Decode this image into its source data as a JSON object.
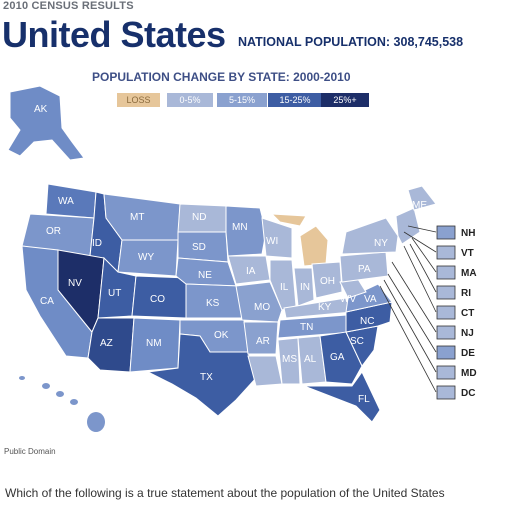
{
  "header": {
    "eyebrow": "2010 CENSUS RESULTS",
    "title": "United States",
    "national_population": "NATIONAL POPULATION: 308,745,538"
  },
  "map": {
    "subtitle": "POPULATION CHANGE BY STATE: 2000-2010",
    "legend": [
      {
        "label": "LOSS",
        "color": "#e6c69a"
      },
      {
        "label": "0-5%",
        "color": "#a9b8d8"
      },
      {
        "label": "5-15%",
        "color": "#8aa1cf"
      },
      {
        "label": "15-25%",
        "color": "#3d5da3"
      },
      {
        "label": "25%+",
        "color": "#1d2e68"
      }
    ],
    "state_labels": {
      "AK": "AK",
      "WA": "WA",
      "OR": "OR",
      "CA": "CA",
      "ID": "ID",
      "NV": "NV",
      "MT": "MT",
      "WY": "WY",
      "UT": "UT",
      "AZ": "AZ",
      "CO": "CO",
      "NM": "NM",
      "ND": "ND",
      "SD": "SD",
      "NE": "NE",
      "KS": "KS",
      "OK": "OK",
      "TX": "TX",
      "MN": "MN",
      "IA": "IA",
      "MO": "MO",
      "AR": "AR",
      "WI": "WI",
      "IL": "IL",
      "IN": "IN",
      "OH": "OH",
      "KY": "KY",
      "TN": "TN",
      "MS": "MS",
      "AL": "AL",
      "GA": "GA",
      "FL": "FL",
      "SC": "SC",
      "NC": "NC",
      "VA": "VA",
      "WV": "WV",
      "PA": "PA",
      "NY": "NY",
      "ME": "ME"
    },
    "northeast_labels": [
      "NH",
      "VT",
      "MA",
      "RI",
      "CT",
      "NJ",
      "DE",
      "MD",
      "DC"
    ]
  },
  "credit": "Public Domain",
  "question": "Which of the following is a true statement about the population of the United States"
}
